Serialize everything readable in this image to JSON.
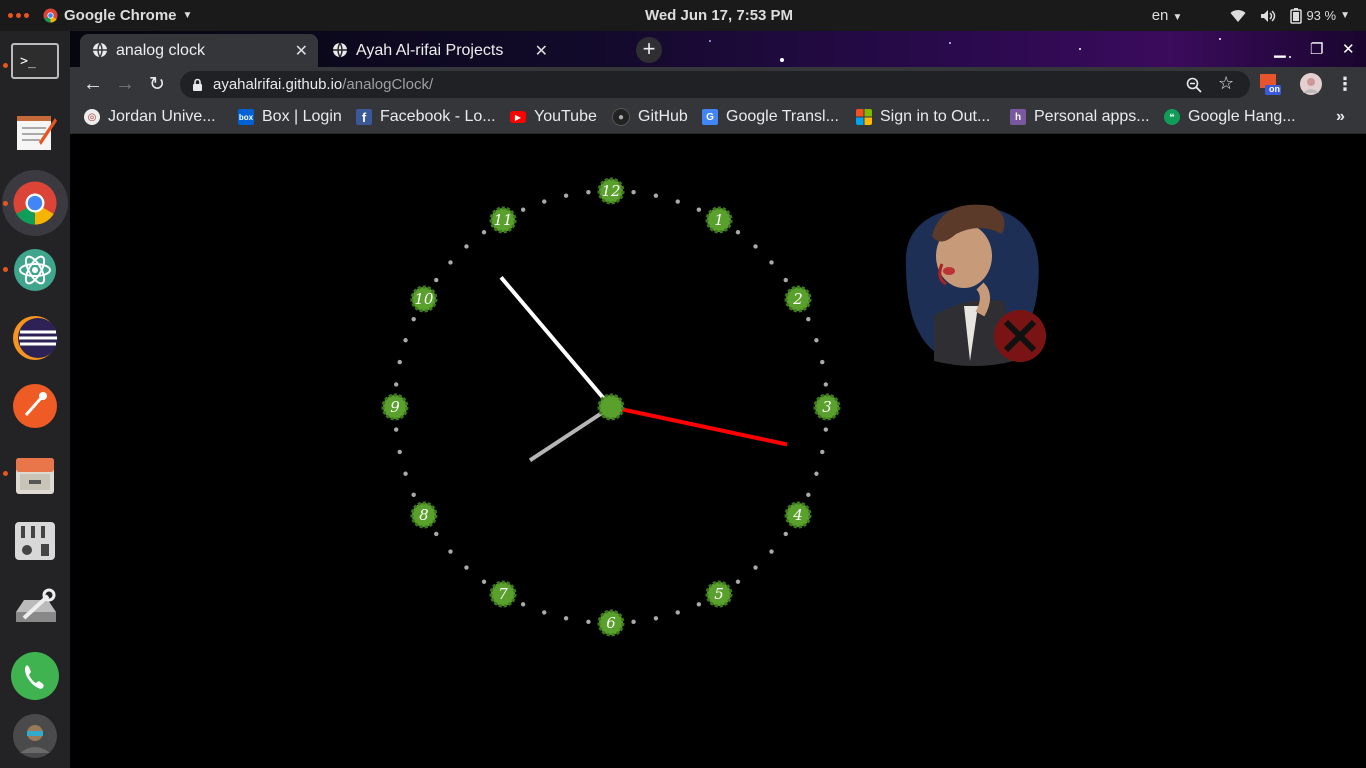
{
  "system_bar": {
    "app_name": "Google Chrome",
    "clock": "Wed Jun 17,  7:53 PM",
    "language": "en",
    "battery": "93 %"
  },
  "dock": {
    "items": [
      {
        "name": "terminal",
        "icon": "terminal-icon"
      },
      {
        "name": "text-editor",
        "icon": "notepad-icon"
      },
      {
        "name": "google-chrome",
        "icon": "chrome-icon"
      },
      {
        "name": "atom",
        "icon": "atom-icon"
      },
      {
        "name": "eclipse",
        "icon": "eclipse-icon"
      },
      {
        "name": "postman",
        "icon": "postman-icon"
      },
      {
        "name": "files",
        "icon": "file-cabinet-icon"
      },
      {
        "name": "settings",
        "icon": "mixer-icon"
      },
      {
        "name": "system-tools",
        "icon": "wrench-drive-icon"
      },
      {
        "name": "phone",
        "icon": "phone-icon"
      },
      {
        "name": "user",
        "icon": "avatar-icon"
      }
    ]
  },
  "browser": {
    "tabs": [
      {
        "title": "analog clock",
        "active": true
      },
      {
        "title": "Ayah Al-rifai Projects",
        "active": false
      }
    ],
    "url_host": "ayahalrifai.github.io",
    "url_path": "/analogClock/",
    "bookmarks": [
      {
        "label": "Jordan Unive...",
        "icon": "university-seal-icon"
      },
      {
        "label": "Box | Login",
        "icon": "box-icon"
      },
      {
        "label": "Facebook - Lo...",
        "icon": "facebook-icon"
      },
      {
        "label": "YouTube",
        "icon": "youtube-icon"
      },
      {
        "label": "GitHub",
        "icon": "github-icon"
      },
      {
        "label": "Google Transl...",
        "icon": "google-translate-icon"
      },
      {
        "label": "Sign in to Out...",
        "icon": "microsoft-icon"
      },
      {
        "label": "Personal apps...",
        "icon": "heroku-icon"
      },
      {
        "label": "Google Hang...",
        "icon": "hangouts-icon"
      }
    ],
    "extension_badge": "on"
  },
  "clock": {
    "numerals": [
      "12",
      "1",
      "2",
      "3",
      "4",
      "5",
      "6",
      "7",
      "8",
      "9",
      "10",
      "11"
    ],
    "hours": 7,
    "minutes": 53,
    "seconds": 17,
    "colors": {
      "hour_hand": "#b5b5b5",
      "minute_hand": "#ffffff",
      "second_hand": "#ff0000",
      "marker": "#5aa02c"
    }
  }
}
